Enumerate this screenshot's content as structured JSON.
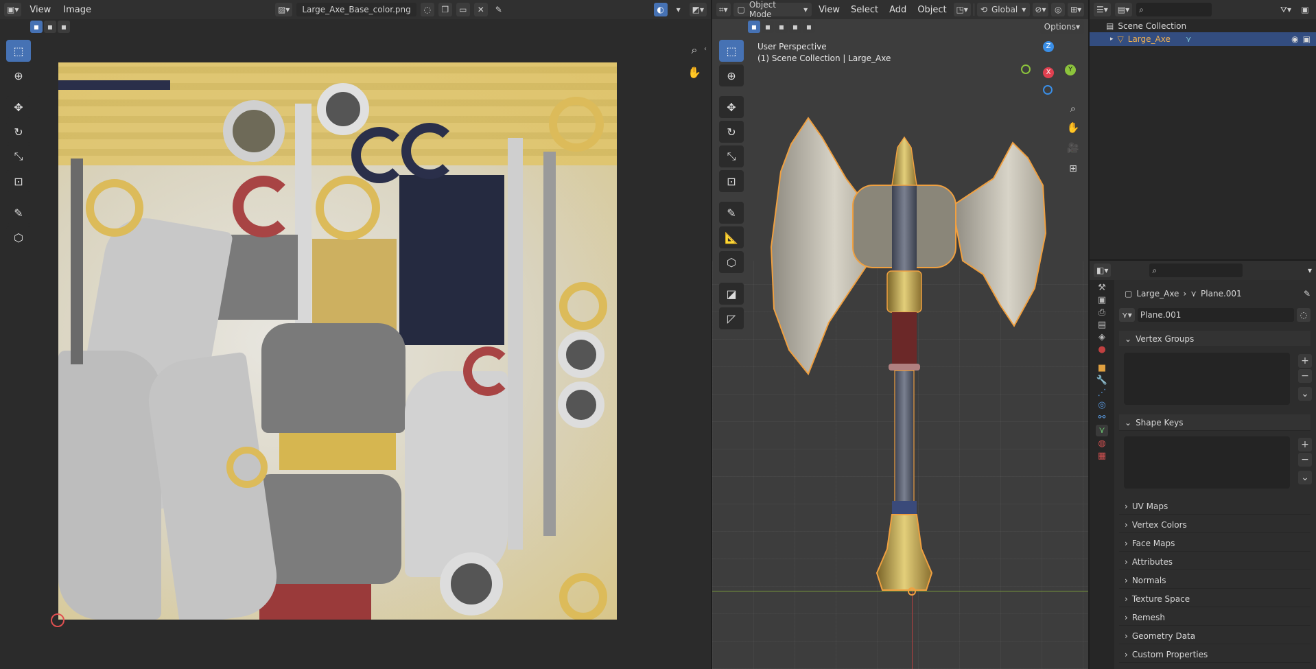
{
  "image_editor": {
    "menus": [
      "View",
      "Image"
    ],
    "image_name": "Large_Axe_Base_color.png"
  },
  "viewport": {
    "mode_label": "Object Mode",
    "menus": [
      "View",
      "Select",
      "Add",
      "Object"
    ],
    "transform_orientation": "Global",
    "options_label": "Options",
    "perspective_label": "User Perspective",
    "collection_label": "(1) Scene Collection | Large_Axe",
    "gizmo": {
      "x": "X",
      "y": "Y",
      "z": "Z"
    }
  },
  "outliner": {
    "root": "Scene Collection",
    "items": [
      {
        "label": "Large_Axe"
      }
    ]
  },
  "properties": {
    "breadcrumb_object": "Large_Axe",
    "breadcrumb_data": "Plane.001",
    "mesh_name": "Plane.001",
    "sections": {
      "vertex_groups": "Vertex Groups",
      "shape_keys": "Shape Keys",
      "uv_maps": "UV Maps",
      "vertex_colors": "Vertex Colors",
      "face_maps": "Face Maps",
      "attributes": "Attributes",
      "normals": "Normals",
      "texture_space": "Texture Space",
      "remesh": "Remesh",
      "geometry_data": "Geometry Data",
      "custom_properties": "Custom Properties"
    }
  },
  "colors": {
    "accent": "#4672b4",
    "selection_orange": "#f0a040",
    "axis_x": "#e04050",
    "axis_y": "#8cc43c",
    "axis_z": "#3a8ee6"
  }
}
